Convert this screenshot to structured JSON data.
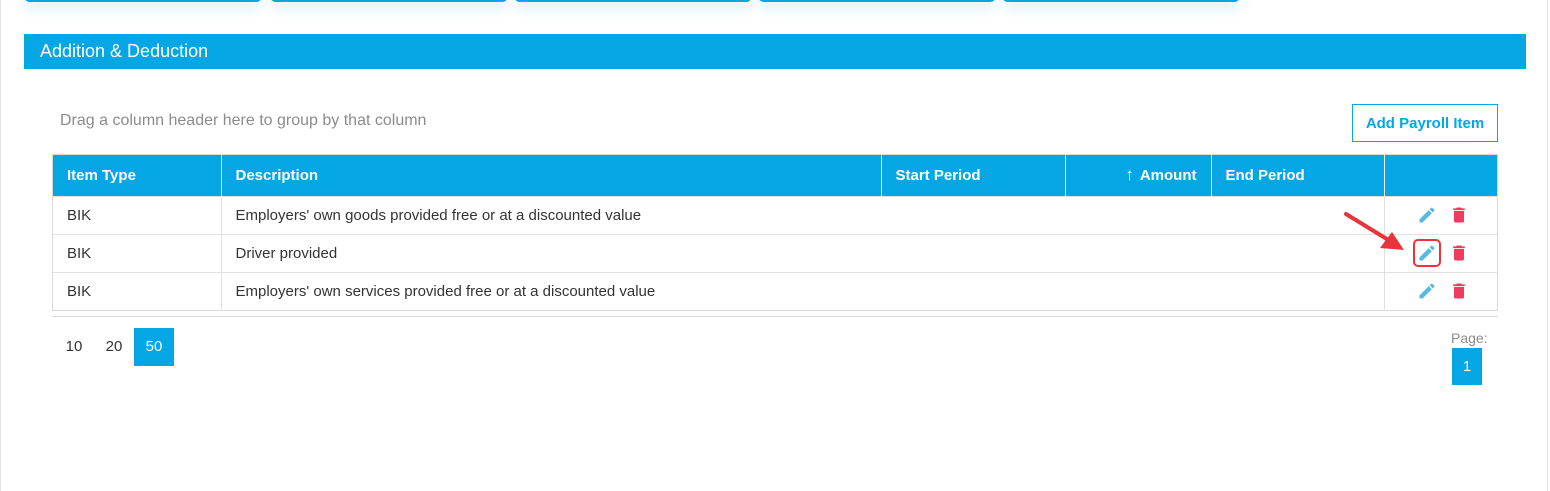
{
  "section": {
    "title": "Addition & Deduction"
  },
  "toolbar": {
    "group_hint": "Drag a column header here to group by that column",
    "add_label": "Add Payroll Item"
  },
  "table": {
    "columns": [
      "Item Type",
      "Description",
      "Start Period",
      "Amount",
      "End Period",
      ""
    ],
    "sorted_column": "Amount",
    "sort_direction": "ascending",
    "rows": [
      {
        "item_type": "BIK",
        "description": "Employers' own goods provided free or at a discounted value",
        "start_period": "",
        "amount": "",
        "end_period": ""
      },
      {
        "item_type": "BIK",
        "description": "Driver provided",
        "start_period": "",
        "amount": "",
        "end_period": ""
      },
      {
        "item_type": "BIK",
        "description": "Employers' own services provided free or at a discounted value",
        "start_period": "",
        "amount": "",
        "end_period": ""
      }
    ],
    "row_actions": {
      "edit_icon": "pencil-icon",
      "delete_icon": "trash-icon"
    }
  },
  "pager": {
    "page_sizes": [
      "10",
      "20",
      "50"
    ],
    "selected_size": "50",
    "page_label": "Page:",
    "current_page": "1"
  },
  "colors": {
    "accent": "#04a7e3",
    "delete": "#ef3b5d",
    "edit": "#5bb8e0",
    "annotation": "#e8343a"
  }
}
